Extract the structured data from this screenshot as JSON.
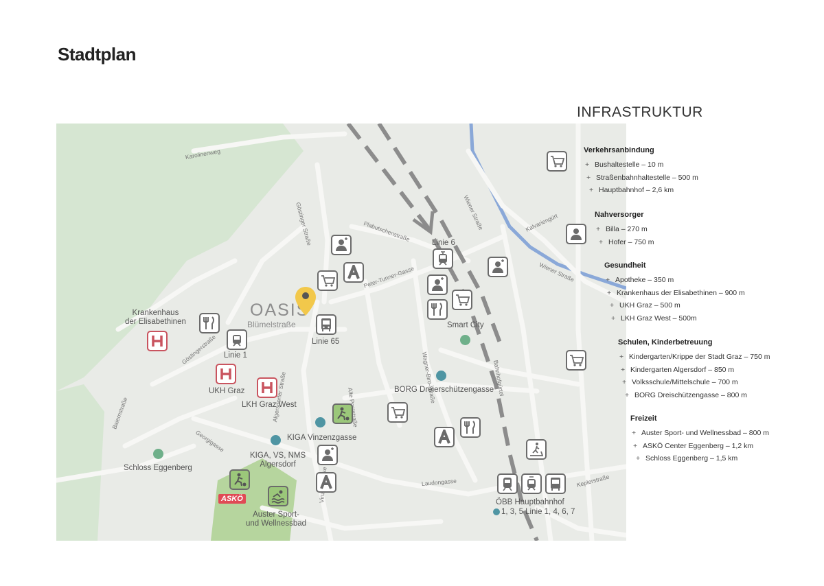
{
  "page_title": "Stadtplan",
  "infra": {
    "title": "INFRASTRUKTUR",
    "sections": [
      {
        "heading": "Verkehrsanbindung",
        "items": [
          "Bushaltestelle – 10 m",
          "Straßenbahnhaltestelle – 500 m",
          "Hauptbahnhof – 2,6 km"
        ]
      },
      {
        "heading": "Nahversorger",
        "items": [
          "Billa – 270 m",
          "Hofer – 750 m"
        ]
      },
      {
        "heading": "Gesundheit",
        "items": [
          "Apotheke – 350 m",
          "Krankenhaus der Elisabethinen – 900 m",
          "UKH Graz – 500 m",
          "LKH Graz West – 500m"
        ]
      },
      {
        "heading": "Schulen, Kinderbetreuung",
        "items": [
          "Kindergarten/Krippe der Stadt Graz – 750 m",
          "Kindergarten Algersdorf – 850 m",
          "Volksschule/Mittelschule – 700 m",
          "BORG Dreischützengasse – 800 m"
        ]
      },
      {
        "heading": "Freizeit",
        "items": [
          "Auster Sport- und Wellnessbad – 800 m",
          "ASKÖ Center Eggenberg – 1,2 km",
          "Schloss Eggenberg – 1,5 km"
        ]
      }
    ]
  },
  "map": {
    "oasis": "OASIS",
    "oasis_sub": "Blümelstraße",
    "asko_badge": "ASKÖ",
    "labels": {
      "krankenhaus": "Krankenhaus\nder Elisabethinen",
      "linie1": "Linie 1",
      "linie65": "Linie 65",
      "linie6": "Linie 6",
      "ukh": "UKH Graz",
      "lkh": "LKH Graz West",
      "smart_city": "Smart City",
      "borg": "BORG Dreierschützengasse",
      "kiga": "KIGA Vinzenzgasse",
      "kiga_vs": "KIGA, VS, NMS\nAlgersdorf",
      "schloss": "Schloss Eggenberg",
      "auster": "Auster Sport-\nund Wellnessbad",
      "obb": "ÖBB Hauptbahnhof",
      "obb_lines": "1, 3, 5   Linie 1, 4, 6, 7"
    },
    "streets": {
      "karolinenweg": "Karolinenweg",
      "gostinger": "Göstinger Straße",
      "plabutsch": "Plabutschenstraße",
      "peter_tunner": "Peter-Tunner-Gasse",
      "wiener": "Wiener Straße",
      "wiener2": "Wiener Straße",
      "kalvarien": "Kalvariengürt",
      "bahnhof": "Bahnhofgürtel",
      "wagner": "Wagner-Biro-Straße",
      "alte_post": "Alte Poststraße",
      "algersdorfer": "Algersdorfer Straße",
      "gostingerstr": "Göstingerstraße",
      "baiern": "Baiernstraße",
      "georgi": "Georgigasse",
      "vinzenz": "Vinzenzgasse",
      "laudon": "Laudongasse",
      "kepler": "Keplerstraße"
    },
    "colors": {
      "map_bg": "#e9ebe7",
      "green": "#d6e6d2",
      "poi_border": "#6b6b6b",
      "hospital": "#c9545f",
      "school_dot": "#4f95a3",
      "park_dot": "#6fb08a",
      "pin": "#f2c84b",
      "sport": "#9bc77a",
      "river": "#8aa8d8"
    }
  }
}
